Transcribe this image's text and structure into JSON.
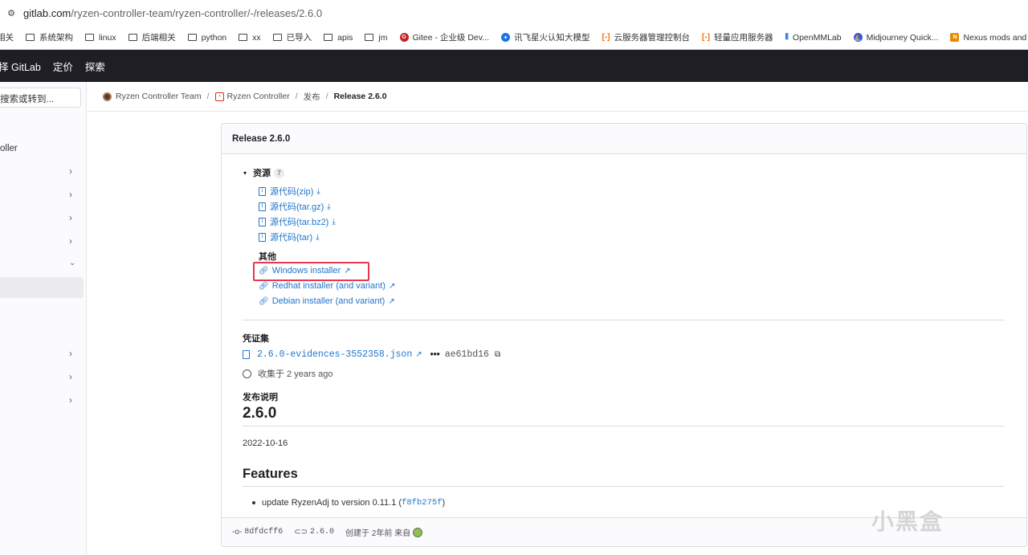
{
  "browser": {
    "tune_icon": "site-settings-icon",
    "url_domain": "gitlab.com",
    "url_path": "/ryzen-controller-team/ryzen-controller/-/releases/2.6.0"
  },
  "bookmarks": [
    {
      "label": "相关",
      "icon": "folder"
    },
    {
      "label": "系统架构",
      "icon": "folder"
    },
    {
      "label": "linux",
      "icon": "folder"
    },
    {
      "label": "后端相关",
      "icon": "folder"
    },
    {
      "label": "python",
      "icon": "folder"
    },
    {
      "label": "xx",
      "icon": "folder"
    },
    {
      "label": "已导入",
      "icon": "folder"
    },
    {
      "label": "apis",
      "icon": "folder"
    },
    {
      "label": "jm",
      "icon": "folder"
    },
    {
      "label": "Gitee - 企业级 Dev...",
      "icon": "gitee",
      "color": "#c71d23"
    },
    {
      "label": "讯飞星火认知大模型",
      "icon": "spark",
      "color": "#1a73e8"
    },
    {
      "label": "云服务器管理控制台",
      "icon": "aliyun",
      "color": "#ff6a00"
    },
    {
      "label": "轻量应用服务器",
      "icon": "aliyun",
      "color": "#ff6a00"
    },
    {
      "label": "OpenMMLab",
      "icon": "openmmlab",
      "color": "#1a73e8"
    },
    {
      "label": "Midjourney Quick...",
      "icon": "midjourney",
      "color": "#2b5fd9"
    },
    {
      "label": "Nexus mods and c...",
      "icon": "nexus",
      "color": "#e68a00"
    }
  ],
  "topnav": {
    "items": [
      "择 GitLab",
      "定价",
      "探索"
    ]
  },
  "sidebar": {
    "search_placeholder": "搜索或转到...",
    "project_title": "oller"
  },
  "breadcrumb": {
    "group": "Ryzen Controller Team",
    "project": "Ryzen Controller",
    "section": "发布",
    "current": "Release 2.6.0"
  },
  "release": {
    "title": "Release 2.6.0",
    "assets_label": "资源",
    "assets_count": "7",
    "sources": [
      "源代码(zip)",
      "源代码(tar.gz)",
      "源代码(tar.bz2)",
      "源代码(tar)"
    ],
    "other_label": "其他",
    "links": [
      "Windows installer",
      "Redhat installer (and variant)",
      "Debian installer (and variant)"
    ],
    "evidence_label": "凭证集",
    "evidence_file": "2.6.0-evidences-3552358.json",
    "evidence_sha": "ae61bd16",
    "collected": "收集于 2 years ago",
    "notes_label": "发布说明",
    "notes_h1": "2.6.0",
    "notes_date": "2022-10-16",
    "features_h2": "Features",
    "feature_text": "update RyzenAdj to version 0.11.1 (",
    "feature_commit": "f8fb275f",
    "feature_close": ")",
    "footer_commit": "8dfdcff6",
    "footer_tag": "2.6.0",
    "footer_created": "创建于 2年前 来自"
  },
  "watermark": "小黑盒",
  "colors": {
    "link": "#1f75cb",
    "highlight": "#e8384f",
    "nav": "#1f1e24"
  }
}
